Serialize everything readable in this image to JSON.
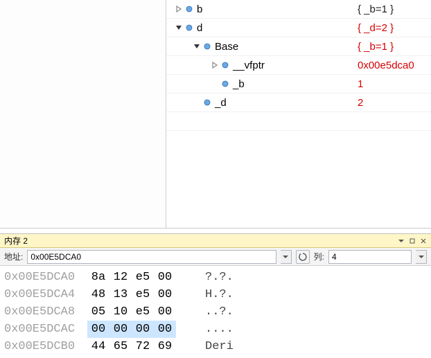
{
  "tree": {
    "rows": [
      {
        "indent": 0,
        "expander": "right",
        "name": "b",
        "value": "{ _b=1 }",
        "valueClass": "black"
      },
      {
        "indent": 0,
        "expander": "down",
        "name": "d",
        "value": "{ _d=2 }",
        "valueClass": "red"
      },
      {
        "indent": 1,
        "expander": "down",
        "name": "Base",
        "value": "{ _b=1 }",
        "valueClass": "red"
      },
      {
        "indent": 2,
        "expander": "right",
        "name": "__vfptr",
        "value": "0x00e5dca0",
        "valueClass": "red"
      },
      {
        "indent": 2,
        "expander": "none",
        "name": "_b",
        "value": "1",
        "valueClass": "red"
      },
      {
        "indent": 1,
        "expander": "none",
        "name": "_d",
        "value": "2",
        "valueClass": "red"
      }
    ]
  },
  "memory": {
    "title": "内存 2",
    "address_label": "地址:",
    "address_value": "0x00E5DCA0",
    "columns_label": "列:",
    "columns_value": "4",
    "rows": [
      {
        "addr": "0x00E5DCA0",
        "b0": "8a",
        "b1": "12",
        "b2": "e5",
        "b3": "00",
        "ascii": "?.?.",
        "sel": false
      },
      {
        "addr": "0x00E5DCA4",
        "b0": "48",
        "b1": "13",
        "b2": "e5",
        "b3": "00",
        "ascii": "H.?.",
        "sel": false
      },
      {
        "addr": "0x00E5DCA8",
        "b0": "05",
        "b1": "10",
        "b2": "e5",
        "b3": "00",
        "ascii": "..?.",
        "sel": false
      },
      {
        "addr": "0x00E5DCAC",
        "b0": "00",
        "b1": "00",
        "b2": "00",
        "b3": "00",
        "ascii": "....",
        "sel": true
      },
      {
        "addr": "0x00E5DCB0",
        "b0": "44",
        "b1": "65",
        "b2": "72",
        "b3": "69",
        "ascii": "Deri",
        "sel": false
      }
    ]
  }
}
